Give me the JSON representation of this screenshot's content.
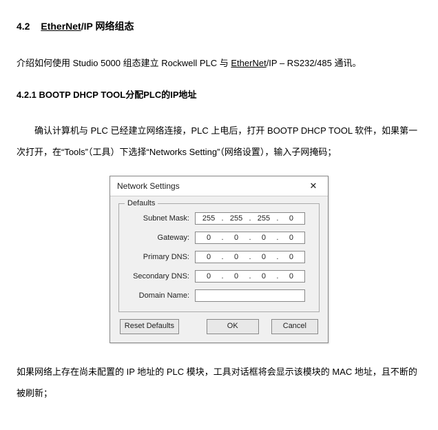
{
  "section": {
    "number": "4.2",
    "title_a": "EtherNet",
    "title_b": "/IP 网络组态"
  },
  "intro_a": "介绍如何使用 Studio 5000 组态建立 Rockwell PLC 与 ",
  "intro_link": "EtherNet",
  "intro_b": "/IP – RS232/485 通讯。",
  "subsection": {
    "number": "4.2.1",
    "title": "BOOTP DHCP TOOL分配PLC的IP地址"
  },
  "para1": "确认计算机与 PLC 已经建立网络连接，PLC 上电后，打开  BOOTP DHCP TOOL 软件，如果第一次打开，在“Tools”（工具）下选择“Networks Setting”（网络设置），输入子网掩码；",
  "dialog": {
    "title": "Network Settings",
    "legend": "Defaults",
    "labels": {
      "subnet": "Subnet Mask:",
      "gateway": "Gateway:",
      "pdns": "Primary DNS:",
      "sdns": "Secondary DNS:",
      "domain": "Domain Name:"
    },
    "subnet": [
      "255",
      "255",
      "255",
      "0"
    ],
    "gateway": [
      "0",
      "0",
      "0",
      "0"
    ],
    "pdns": [
      "0",
      "0",
      "0",
      "0"
    ],
    "sdns": [
      "0",
      "0",
      "0",
      "0"
    ],
    "domain": "",
    "buttons": {
      "reset": "Reset Defaults",
      "ok": "OK",
      "cancel": "Cancel"
    }
  },
  "para2": "如果网络上存在尚未配置的 IP 地址的 PLC 模块，工具对话框将会显示该模块的 MAC 地址，且不断的被刷新；"
}
